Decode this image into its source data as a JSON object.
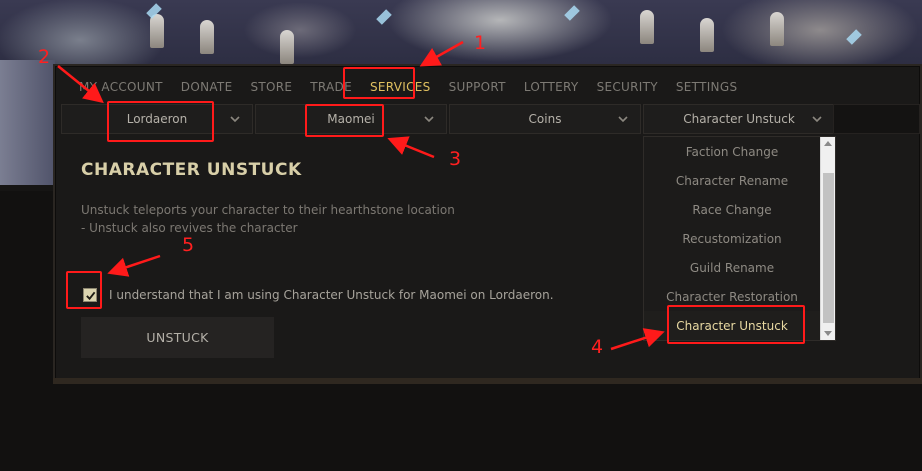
{
  "nav": {
    "items": [
      {
        "label": "MY ACCOUNT"
      },
      {
        "label": "DONATE"
      },
      {
        "label": "STORE"
      },
      {
        "label": "TRADE"
      },
      {
        "label": "SERVICES",
        "active": true
      },
      {
        "label": "SUPPORT"
      },
      {
        "label": "LOTTERY"
      },
      {
        "label": "SECURITY"
      },
      {
        "label": "SETTINGS"
      }
    ]
  },
  "selects": {
    "realm": "Lordaeron",
    "character": "Maomei",
    "currency": "Coins",
    "service": "Character Unstuck"
  },
  "dropdown": {
    "items": [
      "Faction Change",
      "Character Rename",
      "Race Change",
      "Recustomization",
      "Guild Rename",
      "Character Restoration",
      "Character Unstuck"
    ],
    "selected": "Character Unstuck"
  },
  "content": {
    "title": "CHARACTER UNSTUCK",
    "desc_line1": "Unstuck teleports your character to their hearthstone location",
    "desc_line2": "- Unstuck also revives the character",
    "confirm_label": "I understand that I am using Character Unstuck for Maomei on Lordaeron.",
    "confirm_checked": true,
    "button_label": "UNSTUCK"
  },
  "annotations": {
    "numbers": [
      "1",
      "2",
      "3",
      "4",
      "5"
    ],
    "color": "#ff1a1a"
  },
  "colors": {
    "accent_gold": "#e0c060",
    "title_color": "#d8cfa8",
    "panel_bg": "#1a1918"
  }
}
